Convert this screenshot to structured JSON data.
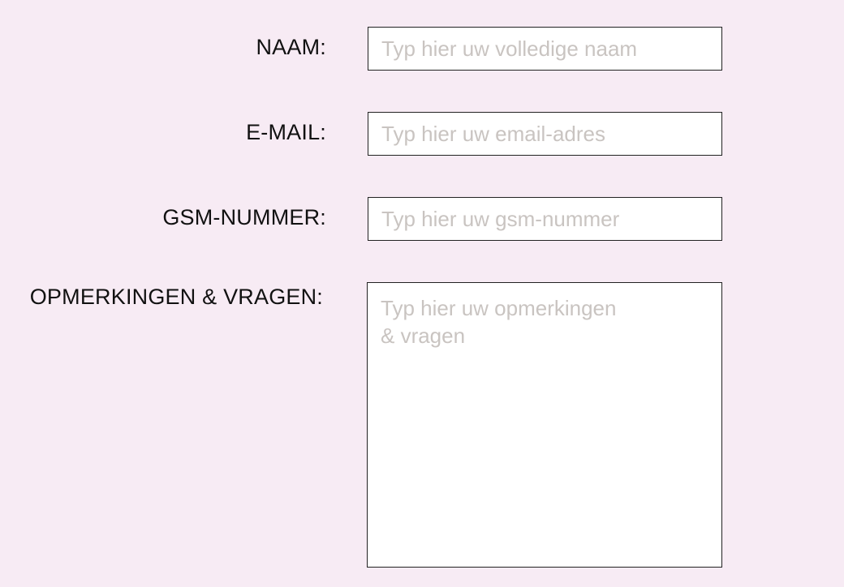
{
  "form": {
    "name": {
      "label": "NAAM:",
      "placeholder": "Typ hier uw volledige naam",
      "value": ""
    },
    "email": {
      "label": "E-MAIL:",
      "placeholder": "Typ hier uw email-adres",
      "value": ""
    },
    "phone": {
      "label": "GSM-NUMMER:",
      "placeholder": "Typ hier uw gsm-nummer",
      "value": ""
    },
    "remarks": {
      "label": "OPMERKINGEN & VRAGEN:",
      "placeholder": "Typ hier uw opmerkingen\n& vragen",
      "value": ""
    }
  }
}
